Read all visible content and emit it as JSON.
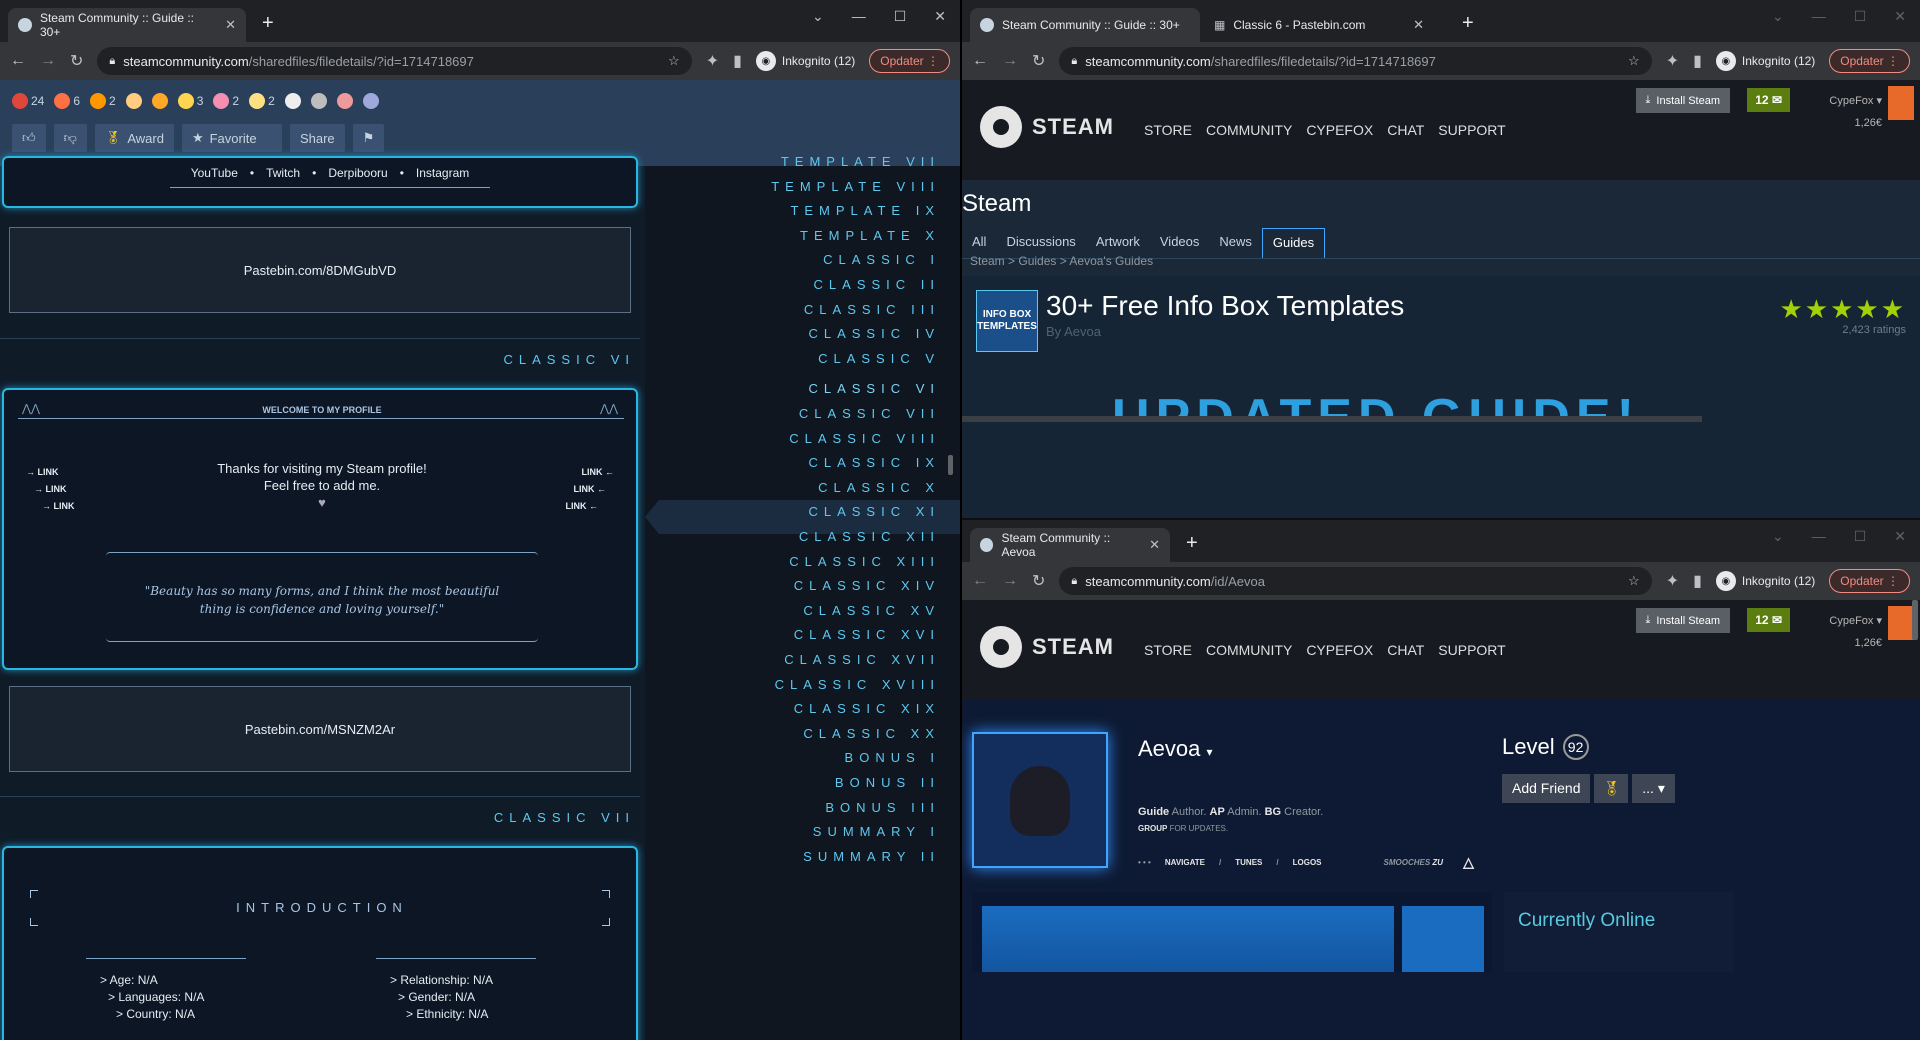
{
  "left": {
    "tabs": [
      {
        "title": "Steam Community :: Guide :: 30+"
      }
    ],
    "url_host": "steamcommunity.com",
    "url_path": "/sharedfiles/filedetails/?id=1714718697",
    "incognito": "Inkognito (12)",
    "update": "Opdater",
    "badges": [
      {
        "count": "24",
        "color": "#e0473a"
      },
      {
        "count": "6",
        "color": "#ff7043"
      },
      {
        "count": "2",
        "color": "#ff9800"
      },
      {
        "count": "",
        "color": "#ffcc80"
      },
      {
        "count": "",
        "color": "#ffa726"
      },
      {
        "count": "3",
        "color": "#ffd54f"
      },
      {
        "count": "2",
        "color": "#f48fb1"
      },
      {
        "count": "2",
        "color": "#ffe082"
      },
      {
        "count": "",
        "color": "#eeeeee"
      },
      {
        "count": "",
        "color": "#bdbdbd"
      },
      {
        "count": "",
        "color": "#ef9a9a"
      },
      {
        "count": "",
        "color": "#9fa8da"
      }
    ],
    "buttons": {
      "award": "Award",
      "favorite": "Favorite",
      "share": "Share"
    },
    "social": {
      "a": "YouTube",
      "b": "Twitch",
      "c": "Derpibooru",
      "d": "Instagram",
      "dot": "•"
    },
    "paste1": "Pastebin.com/8DMGubVD",
    "section_vi": "CLASSIC VI",
    "welcome": "WELCOME TO MY PROFILE",
    "link": "LINK",
    "thanks": "Thanks for visiting my Steam profile!",
    "feelfree": "Feel free to add me.",
    "heart": "♥",
    "quote": "\"Beauty has so many forms, and I think the most beautiful thing is confidence and loving yourself.\"",
    "paste2": "Pastebin.com/MSNZM2Ar",
    "section_vii": "CLASSIC VII",
    "intro": "INTRODUCTION",
    "fields_l": [
      "> Age: N/A",
      "> Languages: N/A",
      "> Country: N/A"
    ],
    "fields_r": [
      "> Relationship: N/A",
      "> Gender: N/A",
      "> Ethnicity: N/A"
    ],
    "toc": [
      "TEMPLATE VII",
      "TEMPLATE VIII",
      "TEMPLATE IX",
      "TEMPLATE X",
      "CLASSIC I",
      "CLASSIC II",
      "CLASSIC III",
      "CLASSIC IV",
      "CLASSIC V",
      "CLASSIC VI",
      "CLASSIC VII",
      "CLASSIC VIII",
      "CLASSIC IX",
      "CLASSIC X",
      "CLASSIC XI",
      "CLASSIC XII",
      "CLASSIC XIII",
      "CLASSIC XIV",
      "CLASSIC XV",
      "CLASSIC XVI",
      "CLASSIC XVII",
      "CLASSIC XVIII",
      "CLASSIC XIX",
      "CLASSIC XX",
      "BONUS I",
      "BONUS II",
      "BONUS III",
      "SUMMARY I",
      "SUMMARY II"
    ]
  },
  "rtop": {
    "tab1": "Steam Community :: Guide :: 30+",
    "tab2": "Classic 6 - Pastebin.com",
    "url_host": "steamcommunity.com",
    "url_path": "/sharedfiles/filedetails/?id=1714718697",
    "incognito": "Inkognito (12)",
    "update": "Opdater",
    "install": "Install Steam",
    "msgs": "12",
    "account": "CypeFox",
    "wallet": "1,26€",
    "logo": "STEAM",
    "nav": [
      "STORE",
      "COMMUNITY",
      "CYPEFOX",
      "CHAT",
      "SUPPORT"
    ],
    "app": "Steam",
    "subtabs": [
      "All",
      "Discussions",
      "Artwork",
      "Videos",
      "News",
      "Guides"
    ],
    "breadcrumb": "Steam > Guides > Aevoa's Guides",
    "thumb": "INFO BOX TEMPLATES",
    "title": "30+ Free Info Box Templates",
    "by": "By Aevoa",
    "stars": "★★★★★",
    "rating_value": 5,
    "ratings": "2,423 ratings",
    "banner": "UPDATED GUIDE!"
  },
  "rbot": {
    "tab1": "Steam Community :: Aevoa",
    "url_host": "steamcommunity.com",
    "url_path": "/id/Aevoa",
    "incognito": "Inkognito (12)",
    "update": "Opdater",
    "install": "Install Steam",
    "msgs": "12",
    "account": "CypeFox",
    "wallet": "1,26€",
    "logo": "STEAM",
    "nav": [
      "STORE",
      "COMMUNITY",
      "CYPEFOX",
      "CHAT",
      "SUPPORT"
    ],
    "name": "Aevoa",
    "summary": [
      [
        "Guide",
        " Author. "
      ],
      [
        "AP",
        " Admin. "
      ],
      [
        "BG",
        " Creator."
      ]
    ],
    "group": "GROUP",
    "group_rest": " FOR UPDATES.",
    "links": [
      "NAVIGATE",
      "TUNES",
      "LOGOS"
    ],
    "smooches": "SMOOCHES",
    "zu": "ZU",
    "level_label": "Level",
    "level": "92",
    "add_friend": "Add Friend",
    "more": "...",
    "online": "Currently Online"
  }
}
